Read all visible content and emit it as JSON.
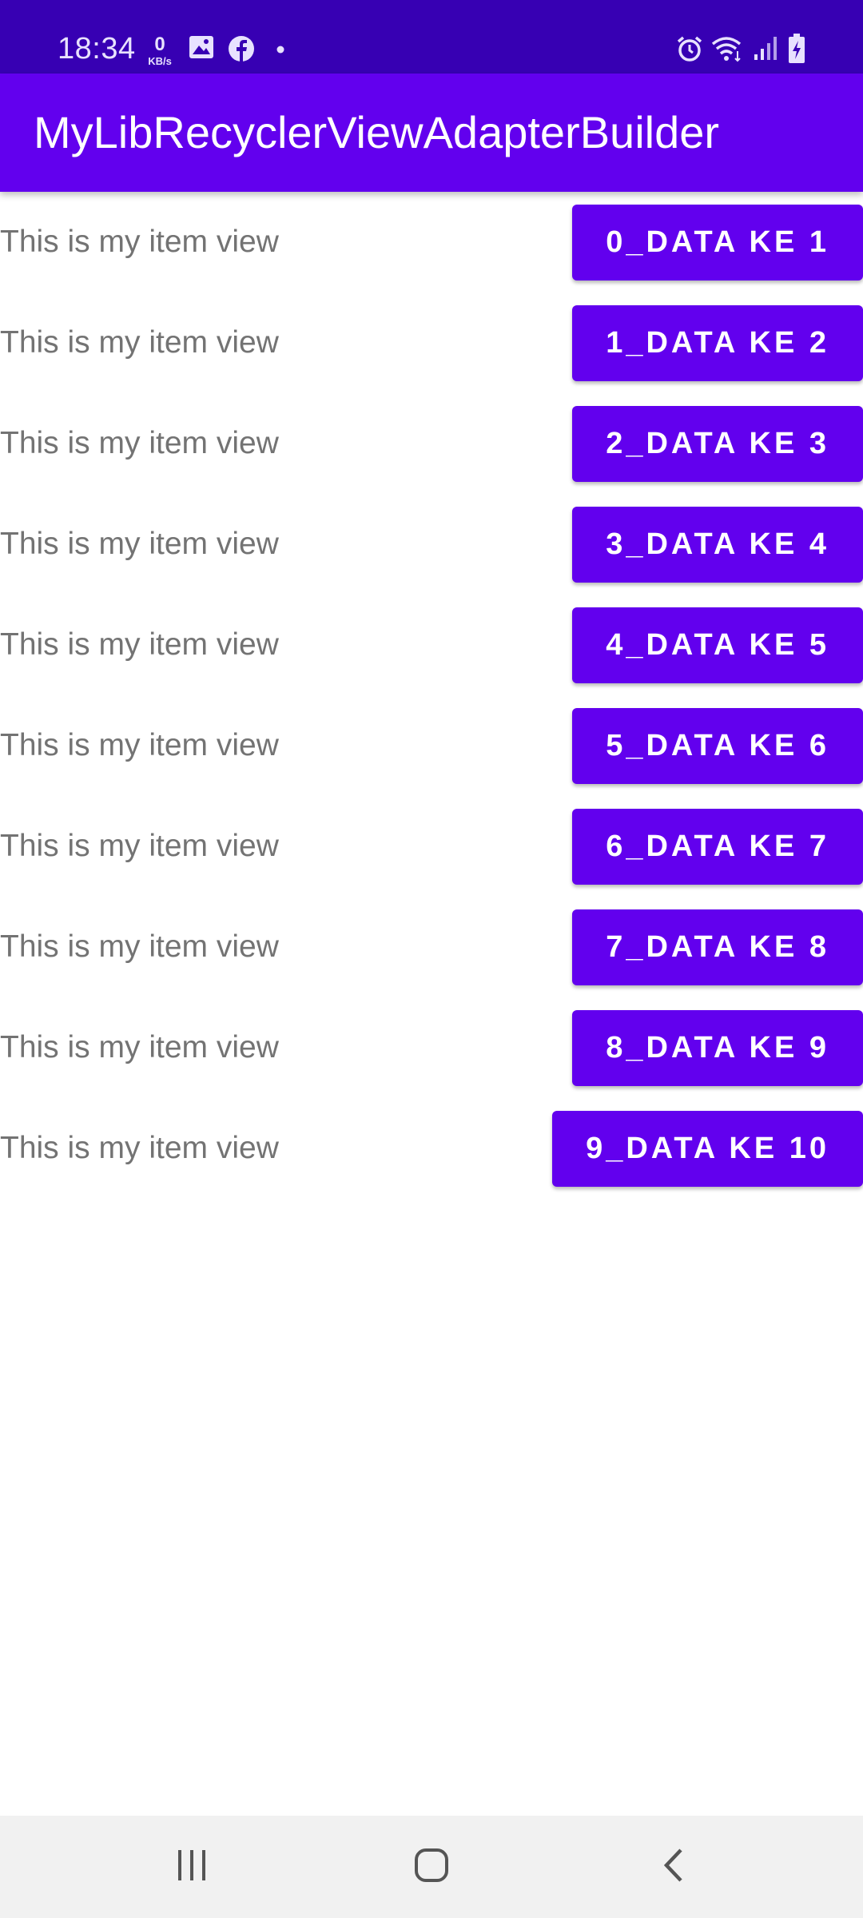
{
  "status_bar": {
    "time": "18:34",
    "net_speed_value": "0",
    "net_speed_unit": "KB/s",
    "icons": [
      "gallery-icon",
      "facebook-icon",
      "notification-dot-icon",
      "alarm-icon",
      "wifi-icon",
      "signal-icon",
      "battery-charging-icon"
    ]
  },
  "app_bar": {
    "title": "MyLibRecyclerViewAdapterBuilder"
  },
  "colors": {
    "primary": "#6200ee",
    "primary_dark": "#3700b3",
    "item_text": "#737373",
    "nav_bar": "#f1f1f1"
  },
  "list": {
    "items": [
      {
        "text": "This is my item view",
        "button": "0_DATA KE 1"
      },
      {
        "text": "This is my item view",
        "button": "1_DATA KE 2"
      },
      {
        "text": "This is my item view",
        "button": "2_DATA KE 3"
      },
      {
        "text": "This is my item view",
        "button": "3_DATA KE 4"
      },
      {
        "text": "This is my item view",
        "button": "4_DATA KE 5"
      },
      {
        "text": "This is my item view",
        "button": "5_DATA KE 6"
      },
      {
        "text": "This is my item view",
        "button": "6_DATA KE 7"
      },
      {
        "text": "This is my item view",
        "button": "7_DATA KE 8"
      },
      {
        "text": "This is my item view",
        "button": "8_DATA KE 9"
      },
      {
        "text": "This is my item view",
        "button": "9_DATA KE 10"
      }
    ]
  },
  "nav_bar": {
    "buttons": [
      "recent-apps-icon",
      "home-icon",
      "back-icon"
    ]
  }
}
